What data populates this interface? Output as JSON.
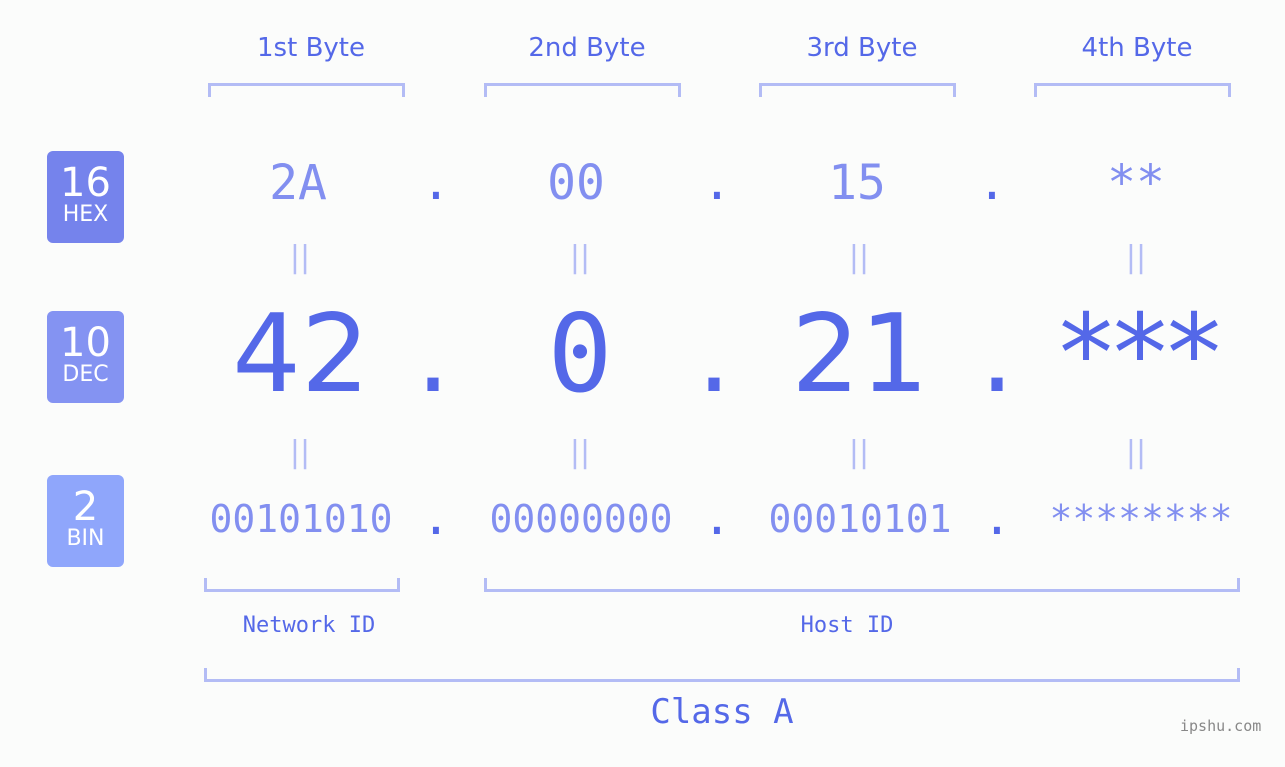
{
  "bytes": [
    "1st Byte",
    "2nd Byte",
    "3rd Byte",
    "4th Byte"
  ],
  "badges": {
    "hex": {
      "num": "16",
      "label": "HEX",
      "color": "#7583ec"
    },
    "dec": {
      "num": "10",
      "label": "DEC",
      "color": "#8493f2"
    },
    "bin": {
      "num": "2",
      "label": "BIN",
      "color": "#8fa6fb"
    }
  },
  "hex": [
    "2A",
    "00",
    "15",
    "**"
  ],
  "dec": [
    "42",
    "0",
    "21",
    "***"
  ],
  "bin": [
    "00101010",
    "00000000",
    "00010101",
    "********"
  ],
  "separator": ".",
  "equals": "||",
  "segments": {
    "network": "Network ID",
    "host": "Host ID"
  },
  "class_label": "Class A",
  "watermark": "ipshu.com"
}
